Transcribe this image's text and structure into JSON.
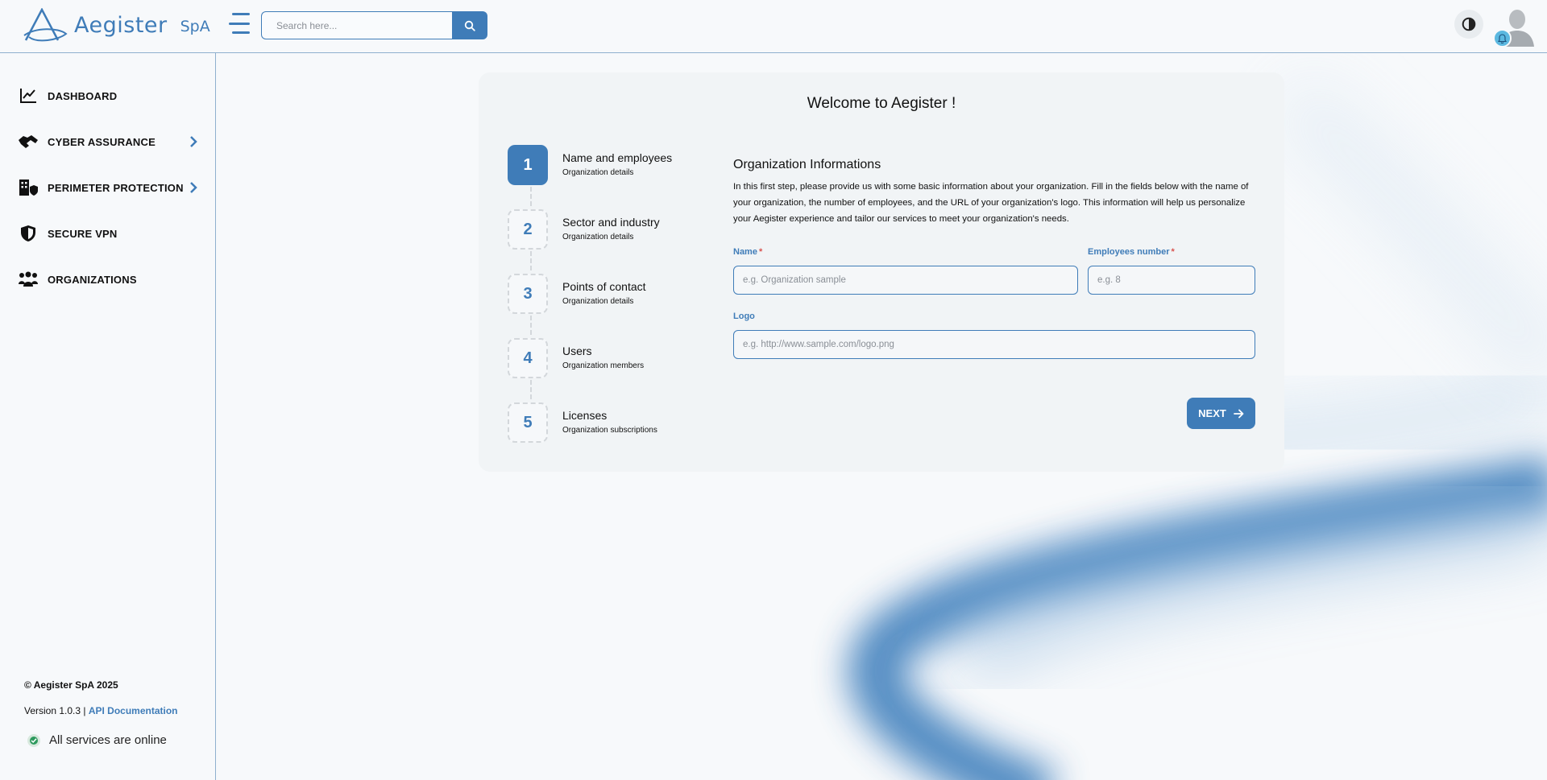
{
  "header": {
    "logo_text": "Aegister",
    "logo_suffix": "SpA",
    "search_placeholder": "Search here..."
  },
  "sidebar": {
    "items": [
      {
        "label": "DASHBOARD",
        "icon": "chart-line-icon",
        "has_submenu": false
      },
      {
        "label": "CYBER ASSURANCE",
        "icon": "handshake-icon",
        "has_submenu": true
      },
      {
        "label": "PERIMETER PROTECTION",
        "icon": "building-shield-icon",
        "has_submenu": true
      },
      {
        "label": "SECURE VPN",
        "icon": "shield-icon",
        "has_submenu": false
      },
      {
        "label": "ORGANIZATIONS",
        "icon": "people-group-icon",
        "has_submenu": false
      }
    ],
    "copyright": "© Aegister SpA 2025",
    "version": "Version 1.0.3 | ",
    "api_link": "API Documentation",
    "status": "All services are online"
  },
  "wizard": {
    "title": "Welcome to Aegister !",
    "steps": [
      {
        "number": "1",
        "title": "Name and employees",
        "subtitle": "Organization details",
        "active": true
      },
      {
        "number": "2",
        "title": "Sector and industry",
        "subtitle": "Organization details",
        "active": false
      },
      {
        "number": "3",
        "title": "Points of contact",
        "subtitle": "Organization details",
        "active": false
      },
      {
        "number": "4",
        "title": "Users",
        "subtitle": "Organization members",
        "active": false
      },
      {
        "number": "5",
        "title": "Licenses",
        "subtitle": "Organization subscriptions",
        "active": false
      }
    ],
    "form": {
      "title": "Organization Informations",
      "description": "In this first step, please provide us with some basic information about your organization. Fill in the fields below with the name of your organization, the number of employees, and the URL of your organization's logo. This information will help us personalize your Aegister experience and tailor our services to meet your organization's needs.",
      "name_label": "Name",
      "name_placeholder": "e.g. Organization sample",
      "employees_label": "Employees number",
      "employees_placeholder": "e.g. 8",
      "logo_label": "Logo",
      "logo_placeholder": "e.g. http://www.sample.com/logo.png",
      "required_mark": "*",
      "next_label": "NEXT"
    }
  },
  "colors": {
    "accent": "#3f7cb8",
    "status_online": "#2e9a5e",
    "required": "#d9534f"
  }
}
